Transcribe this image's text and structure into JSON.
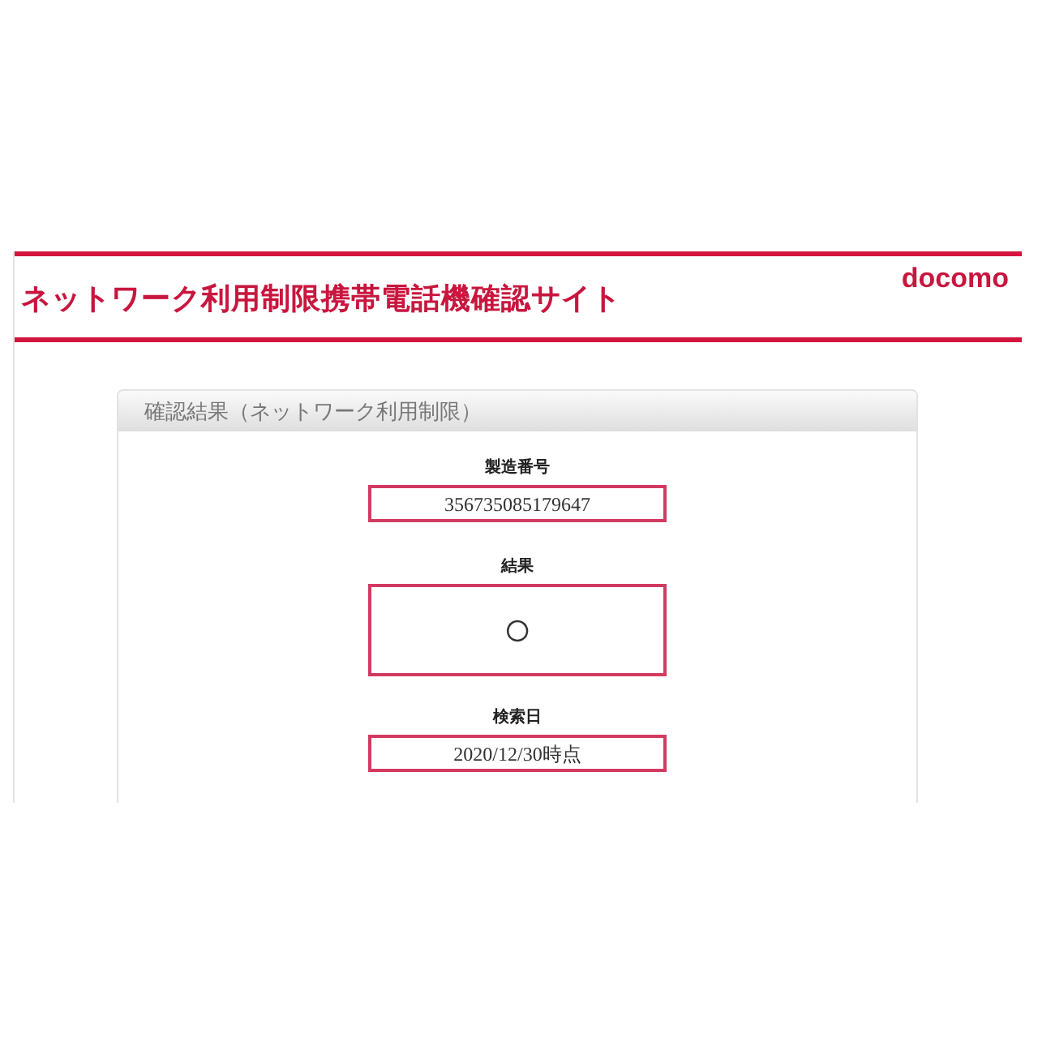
{
  "header": {
    "title": "ネットワーク利用制限携帯電話機確認サイト",
    "logo": "docomo"
  },
  "panel": {
    "title": "確認結果（ネットワーク利用制限）",
    "fields": [
      {
        "label": "製造番号",
        "value": "356735085179647",
        "kind": "text"
      },
      {
        "label": "結果",
        "value": "○",
        "kind": "mark"
      },
      {
        "label": "検索日",
        "value": "2020/12/30時点",
        "kind": "text"
      }
    ]
  }
}
